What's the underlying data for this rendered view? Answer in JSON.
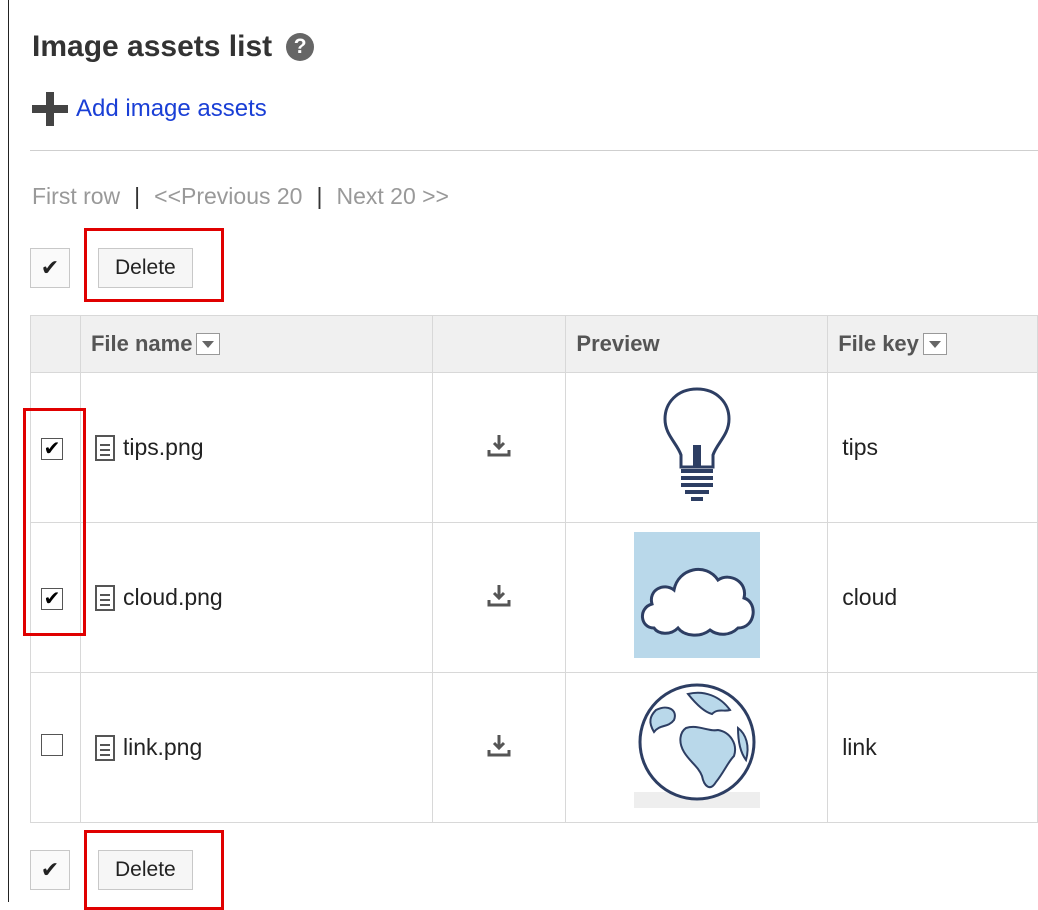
{
  "header": {
    "title": "Image assets list",
    "help_icon": "question-circle-icon",
    "help_glyph": "?"
  },
  "add_link": {
    "label": "Add image assets",
    "icon": "plus-icon"
  },
  "pager": {
    "first": "First row",
    "sep1": "|",
    "prev": "<<Previous 20",
    "sep2": "|",
    "next": "Next 20 >>"
  },
  "toolbar_top": {
    "check_all": "✔",
    "delete_label": "Delete"
  },
  "toolbar_bottom": {
    "check_all": "✔",
    "delete_label": "Delete"
  },
  "table": {
    "columns": {
      "file_name": "File name",
      "download": "",
      "preview": "Preview",
      "file_key": "File key"
    },
    "rows": [
      {
        "checked": true,
        "check_glyph": "✔",
        "file_name": "tips.png",
        "file_key": "tips",
        "preview_icon": "lightbulb-icon"
      },
      {
        "checked": true,
        "check_glyph": "✔",
        "file_name": "cloud.png",
        "file_key": "cloud",
        "preview_icon": "cloud-icon"
      },
      {
        "checked": false,
        "check_glyph": "",
        "file_name": "link.png",
        "file_key": "link",
        "preview_icon": "globe-icon"
      }
    ]
  },
  "colors": {
    "link": "#1a3fd6",
    "highlight": "#e00000",
    "header_bg": "#f0f0f0",
    "cloud_bg": "#b9d8ea",
    "icon_stroke": "#2d3e63"
  }
}
